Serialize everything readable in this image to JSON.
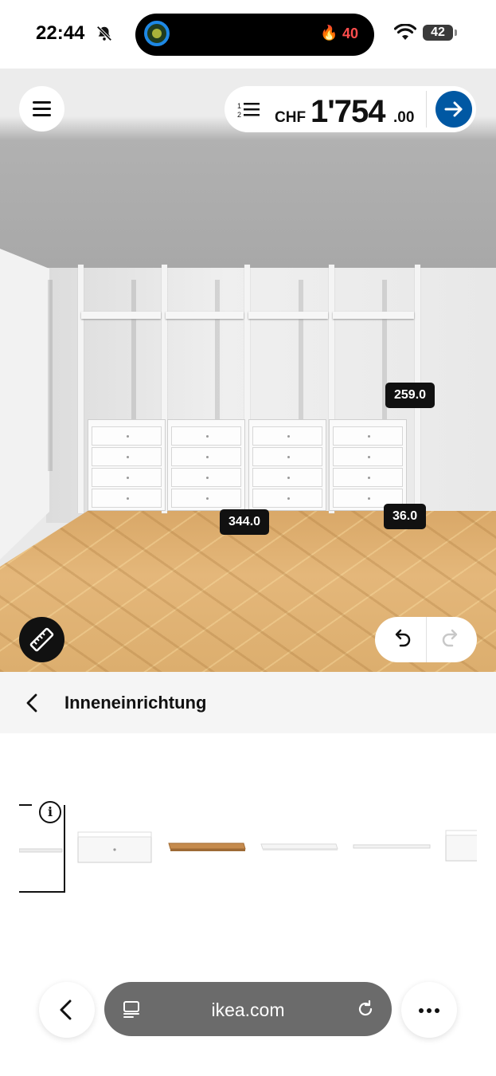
{
  "status_bar": {
    "time": "22:44",
    "streak_count": "40",
    "battery": "42"
  },
  "top_bar": {
    "currency": "CHF",
    "price_main": "1'754",
    "price_cents": ".00"
  },
  "dimensions": {
    "height": "259.0",
    "width": "344.0",
    "depth": "36.0"
  },
  "section": {
    "title": "Inneneinrichtung"
  },
  "products": [
    {
      "name": "selected-item",
      "icon": "info-icon"
    },
    {
      "name": "drawer-white"
    },
    {
      "name": "shelf-wood"
    },
    {
      "name": "shelf-white"
    },
    {
      "name": "rail-white"
    },
    {
      "name": "drawer-white-partial"
    }
  ],
  "browser": {
    "url": "ikea.com"
  },
  "colors": {
    "accent": "#0058a3",
    "badge": "#111111",
    "island_ring": "#1e88e5",
    "streak": "#ff4d4d"
  }
}
